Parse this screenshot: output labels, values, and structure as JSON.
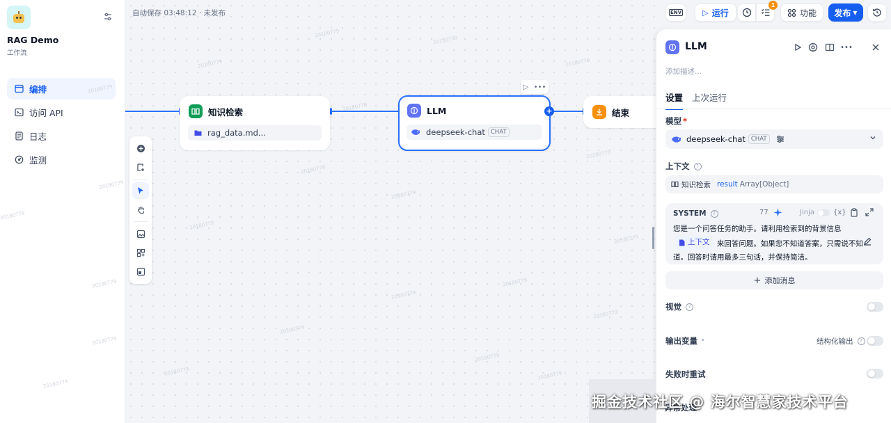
{
  "app": {
    "name": "RAG Demo",
    "type": "工作流"
  },
  "nav": {
    "items": [
      {
        "label": "编排",
        "icon": "layout-icon"
      },
      {
        "label": "访问 API",
        "icon": "terminal-icon"
      },
      {
        "label": "日志",
        "icon": "log-icon"
      },
      {
        "label": "监测",
        "icon": "monitor-icon"
      }
    ]
  },
  "canvas": {
    "autosave": "自动保存 03:48:12 · 未发布",
    "watermark": "20180779",
    "nodes": {
      "knowledge": {
        "title": "知识检索",
        "body": "rag_data.md..."
      },
      "llm": {
        "title": "LLM",
        "model": "deepseek-chat",
        "badge": "CHAT"
      },
      "end": {
        "title": "结束"
      }
    }
  },
  "topbar": {
    "env": "ENV",
    "run": "运行",
    "checklist_count": "1",
    "features": "功能",
    "publish": "发布"
  },
  "panel": {
    "title": "LLM",
    "description_placeholder": "添加描述...",
    "tabs": [
      "设置",
      "上次运行"
    ],
    "model_label": "模型",
    "model_name": "deepseek-chat",
    "model_badge": "CHAT",
    "context_label": "上下文",
    "context_source": "知识检索",
    "context_var": "result",
    "context_type": "Array[Object]",
    "system_label": "SYSTEM",
    "token_count": "77",
    "jinja_label": "Jinja",
    "var_btn": "{x}",
    "prompt_line1": "您是一个问答任务的助手。请利用检索到的背景信息",
    "prompt_ctx_tag": "上下文",
    "prompt_line2": "来回答问题。如果您不知道答案，只需说不知",
    "prompt_line3": "道。回答时请用最多三句话，并保持简洁。",
    "add_message": "添加消息",
    "vision_label": "视觉",
    "output_label": "输出变量",
    "structured_output": "结构化输出",
    "retry_label": "失败时重试",
    "error_label": "异常处理"
  },
  "footer": {
    "brand": "掘金技术社区 @ 海尔智慧家技术平台"
  },
  "colors": {
    "primary": "#155eef",
    "knowledge": "#0f9d58",
    "llm": "#6172f3",
    "end": "#f79009"
  }
}
